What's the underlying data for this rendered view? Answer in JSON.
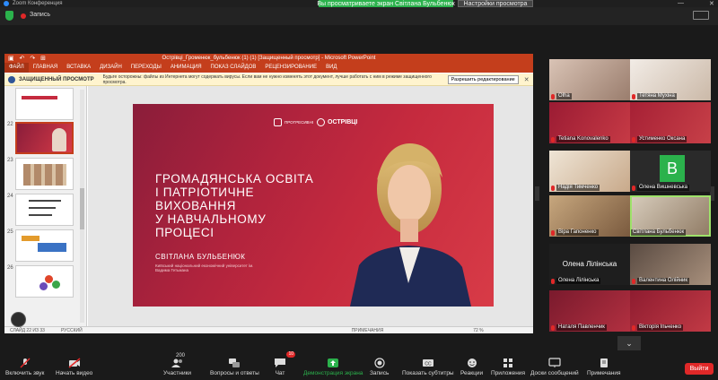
{
  "zoom": {
    "window_title": "Zoom Конференция",
    "recording_label": "Запись",
    "share_banner": "Вы просматриваете экран Світлана Бульбенюк",
    "share_settings": "Настройки просмотра"
  },
  "ppt": {
    "title": "Острівці_Громенюк_бульбенюк (1) (1) [Защищенный просмотр] - Microsoft PowerPoint",
    "tabs": [
      "ФАЙЛ",
      "ГЛАВНАЯ",
      "ВСТАВКА",
      "ДИЗАЙН",
      "ПЕРЕХОДЫ",
      "АНИМАЦИЯ",
      "ПОКАЗ СЛАЙДОВ",
      "РЕЦЕНЗИРОВАНИЕ",
      "ВИД"
    ],
    "protected_title": "ЗАЩИЩЕННЫЙ ПРОСМОТР",
    "protected_text": "Будьте осторожны: файлы из Интернета могут содержать вирусы. Если вам не нужно изменять этот документ, лучше работать с ним в режиме защищенного просмотра.",
    "enable_editing": "Разрешить редактирование",
    "thumbnail_numbers": [
      "22",
      "23",
      "24",
      "25",
      "26"
    ],
    "slide": {
      "logo1": "ПРОГРЕСИВНІ",
      "logo2": "ОСТРІВЦІ",
      "heading_line1": "ГРОМАДЯНСЬКА ОСВІТА",
      "heading_line2": "І ПАТРІОТИЧНЕ ВИХОВАННЯ",
      "heading_line3": "У НАВЧАЛЬНОМУ ПРОЦЕСІ",
      "presenter": "СВІТЛАНА БУЛЬБЕНЮК",
      "institution": "Київський національний економічний університет ім. Вадима Гетьмана"
    },
    "status_slide": "СЛАЙД 22 ИЗ 33",
    "status_lang": "РУССКИЙ",
    "status_notes": "ПРИМЕЧАНИЯ",
    "status_comments": "ПРИМЕЧАНИЯ",
    "zoom_level": "72 %"
  },
  "gallery": [
    {
      "name": "Olha",
      "muted": true
    },
    {
      "name": "Тетяна Мухіна",
      "muted": true
    },
    {
      "name": "Tetiana Konovalenko",
      "muted": true
    },
    {
      "name": "Устименко Оксана",
      "muted": true
    },
    {
      "name": "Надія Тимченко",
      "muted": true
    },
    {
      "name": "Олена Вишневська",
      "muted": true,
      "avatar": "B"
    },
    {
      "name": "Віра Гапоненко",
      "muted": true
    },
    {
      "name": "Світлана Бульбенюк",
      "muted": false,
      "speaking": true
    },
    {
      "name": "Олена Лілінська",
      "muted": true,
      "big_name": "Олена Лілінська"
    },
    {
      "name": "Валентина Олійник",
      "muted": true
    },
    {
      "name": "Наталя Павленчик",
      "muted": true
    },
    {
      "name": "Вікторія Іпьченко",
      "muted": true
    }
  ],
  "toolbar": {
    "mute": "Включить звук",
    "video": "Начать видео",
    "participants": "Участники",
    "participants_count": "200",
    "qa": "Вопросы и ответы",
    "chat": "Чат",
    "chat_badge": "10",
    "share": "Демонстрация экрана",
    "record": "Запись",
    "subtitles": "Показать субтитры",
    "reactions": "Реакции",
    "apps": "Приложения",
    "whiteboards": "Доски сообщений",
    "notes": "Примечания",
    "leave": "Выйти"
  },
  "colors": {
    "ppt_accent": "#c43e1c",
    "zoom_green": "#2bb24c",
    "mute_red": "#e02828",
    "slide_red": "#c52a3e"
  }
}
